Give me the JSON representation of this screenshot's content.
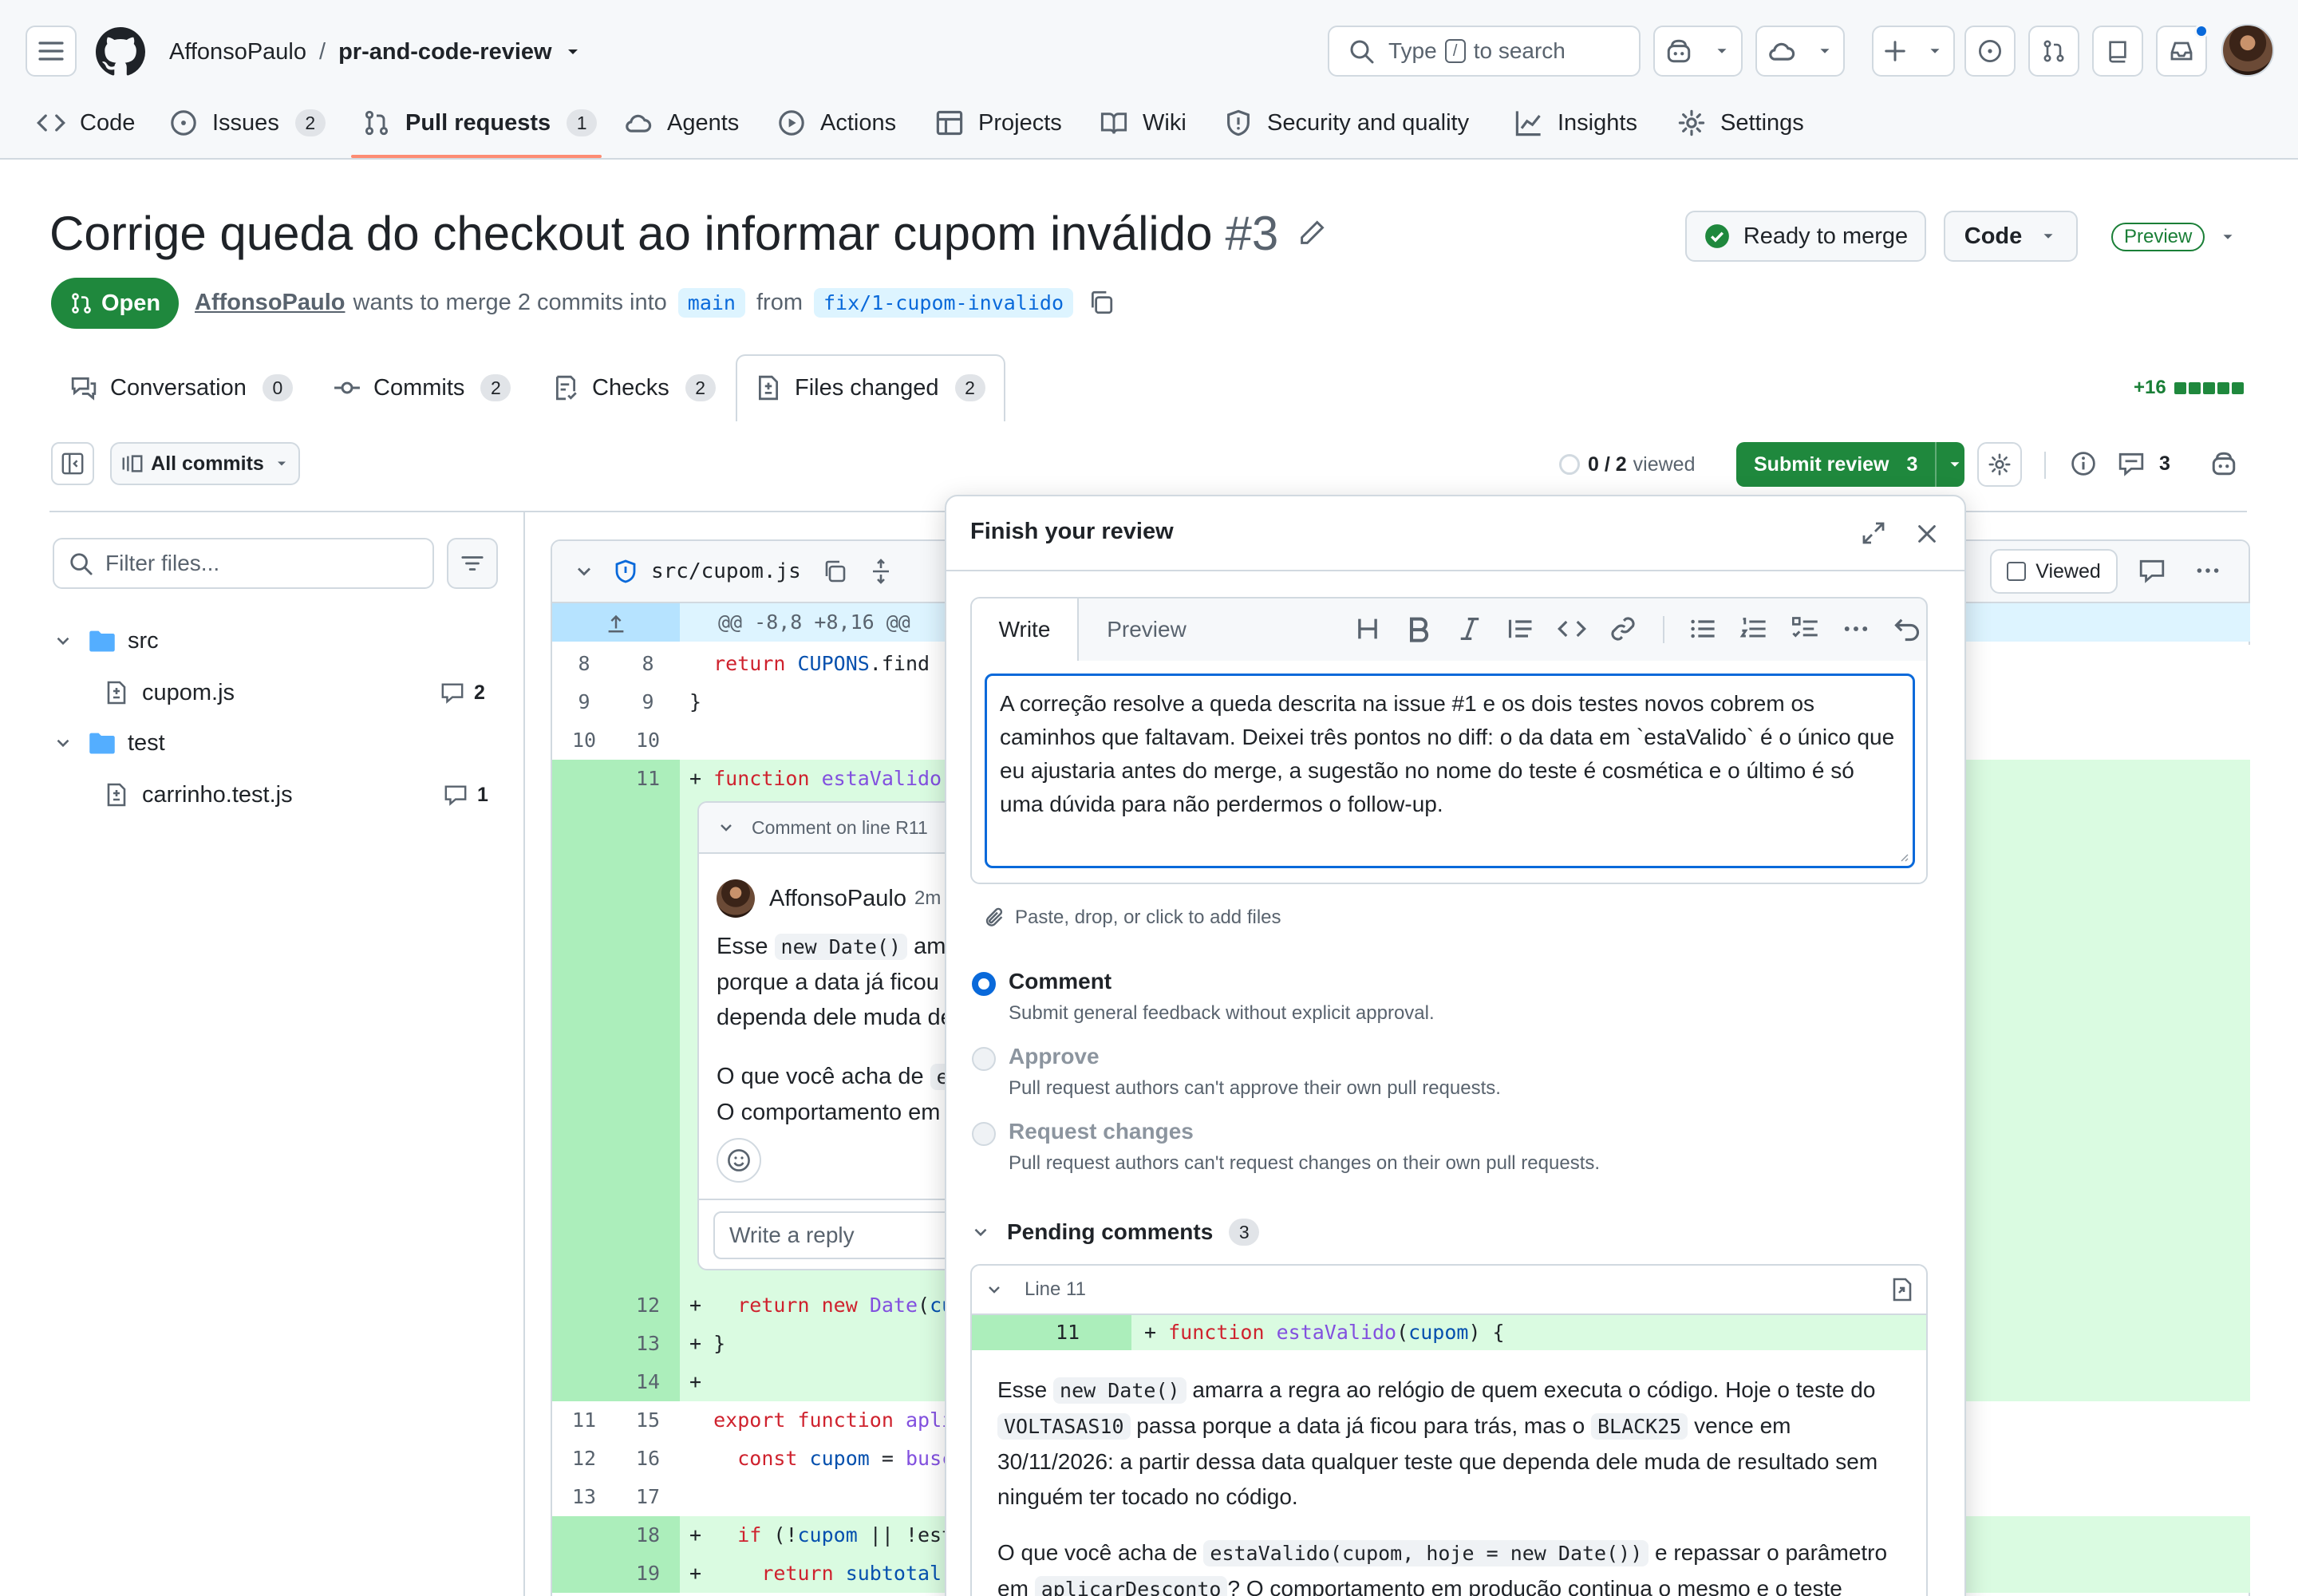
{
  "header": {
    "owner": "AffonsoPaulo",
    "separator": "/",
    "repo": "pr-and-code-review",
    "search_placeholder_pre": "Type",
    "search_key": "/",
    "search_placeholder_post": "to search"
  },
  "repo_nav": {
    "tabs": [
      {
        "label": "Code"
      },
      {
        "label": "Issues",
        "count": "2"
      },
      {
        "label": "Pull requests",
        "count": "1"
      },
      {
        "label": "Agents"
      },
      {
        "label": "Actions"
      },
      {
        "label": "Projects"
      },
      {
        "label": "Wiki"
      },
      {
        "label": "Security and quality"
      },
      {
        "label": "Insights"
      },
      {
        "label": "Settings"
      }
    ]
  },
  "pr": {
    "title": "Corrige queda do checkout ao informar cupom inválido",
    "number": "#3",
    "status": "Open",
    "author": "AffonsoPaulo",
    "merge_text": "wants to merge 2 commits into",
    "base": "main",
    "from_text": "from",
    "head": "fix/1-cupom-invalido",
    "ready_label": "Ready to merge",
    "code_label": "Code",
    "preview_label": "Preview",
    "additions": "+16",
    "tabs": [
      {
        "label": "Conversation",
        "count": "0"
      },
      {
        "label": "Commits",
        "count": "2"
      },
      {
        "label": "Checks",
        "count": "2"
      },
      {
        "label": "Files changed",
        "count": "2"
      }
    ]
  },
  "toolbar": {
    "commits_select": "All commits",
    "viewed_count": "0 / 2",
    "viewed_label": "viewed",
    "submit_label": "Submit review",
    "submit_count": "3",
    "comments_count": "3"
  },
  "file_tree": {
    "filter_placeholder": "Filter files...",
    "items": [
      {
        "name": "src",
        "type": "folder"
      },
      {
        "name": "cupom.js",
        "type": "file",
        "comments": "2"
      },
      {
        "name": "test",
        "type": "folder"
      },
      {
        "name": "carrinho.test.js",
        "type": "file",
        "comments": "1"
      }
    ]
  },
  "diff": {
    "file_path": "src/cupom.js",
    "viewed_label": "Viewed",
    "hunk": "@@ -8,8 +8,16 @@",
    "lines": [
      {
        "old": "8",
        "new": "8",
        "code": "  return CUPONS.find"
      },
      {
        "old": "9",
        "new": "9",
        "code": "}"
      },
      {
        "old": "10",
        "new": "10",
        "code": ""
      },
      {
        "old": "",
        "new": "11",
        "code": "+ function estaValido("
      },
      {
        "old": "",
        "new": "12",
        "code": "+   return new Date(cu"
      },
      {
        "old": "",
        "new": "13",
        "code": "+ }"
      },
      {
        "old": "",
        "new": "14",
        "code": "+"
      },
      {
        "old": "11",
        "new": "15",
        "code": "  export function apli"
      },
      {
        "old": "12",
        "new": "16",
        "code": "    const cupom = busc"
      },
      {
        "old": "13",
        "new": "17",
        "code": ""
      },
      {
        "old": "",
        "new": "18",
        "code": "+   if (!cupom || !est"
      },
      {
        "old": "",
        "new": "19",
        "code": "+     return subtotal;"
      }
    ],
    "thread": {
      "header": "Comment on line R11",
      "author": "AffonsoPaulo",
      "time": "2m",
      "line1_pre": "Esse",
      "line1_code": "new Date()",
      "line1_post": "ama",
      "line2": "porque a data já ficou",
      "line3": "dependa dele muda de",
      "line4": "O que você acha de",
      "line4_code": "e",
      "line5": "O comportamento em",
      "reply_placeholder": "Write a reply"
    }
  },
  "review_panel": {
    "title": "Finish your review",
    "write_tab": "Write",
    "preview_tab": "Preview",
    "body": "A correção resolve a queda descrita na issue #1 e os dois testes novos cobrem os caminhos que faltavam. Deixei três pontos no diff: o da data em `estaValido` é o único que eu ajustaria antes do merge, a sugestão no nome do teste é cosmética e o último é só uma dúvida para não perdermos o follow-up.",
    "attach_hint": "Paste, drop, or click to add files",
    "options": [
      {
        "label": "Comment",
        "desc": "Submit general feedback without explicit approval.",
        "selected": true,
        "disabled": false
      },
      {
        "label": "Approve",
        "desc": "Pull request authors can't approve their own pull requests.",
        "selected": false,
        "disabled": true
      },
      {
        "label": "Request changes",
        "desc": "Pull request authors can't request changes on their own pull requests.",
        "selected": false,
        "disabled": true
      }
    ],
    "pending_label": "Pending comments",
    "pending_count": "3",
    "pending": {
      "line_label": "Line 11",
      "line_number": "11",
      "code": "+ function estaValido(cupom) {",
      "p1_a": "Esse",
      "p1_code1": "new Date()",
      "p1_b": "amarra a regra ao relógio de quem executa o código. Hoje o teste do",
      "p1_code2": "VOLTASAS10",
      "p1_c": "passa porque a data já ficou para trás, mas o",
      "p1_code3": "BLACK25",
      "p1_d": "vence em",
      "p1_e": "30/11/2026: a partir dessa data qualquer teste que dependa dele muda de resultado sem",
      "p1_f": "ninguém ter tocado no código.",
      "p2_a": "O que você acha de",
      "p2_code": "estaValido(cupom, hoje = new Date())",
      "p2_b": "e repassar o parâmetro",
      "p2_c": "em",
      "p2_code2": "aplicarDesconto",
      "p2_d": "? O comportamento em produção continua o mesmo e o teste"
    }
  }
}
